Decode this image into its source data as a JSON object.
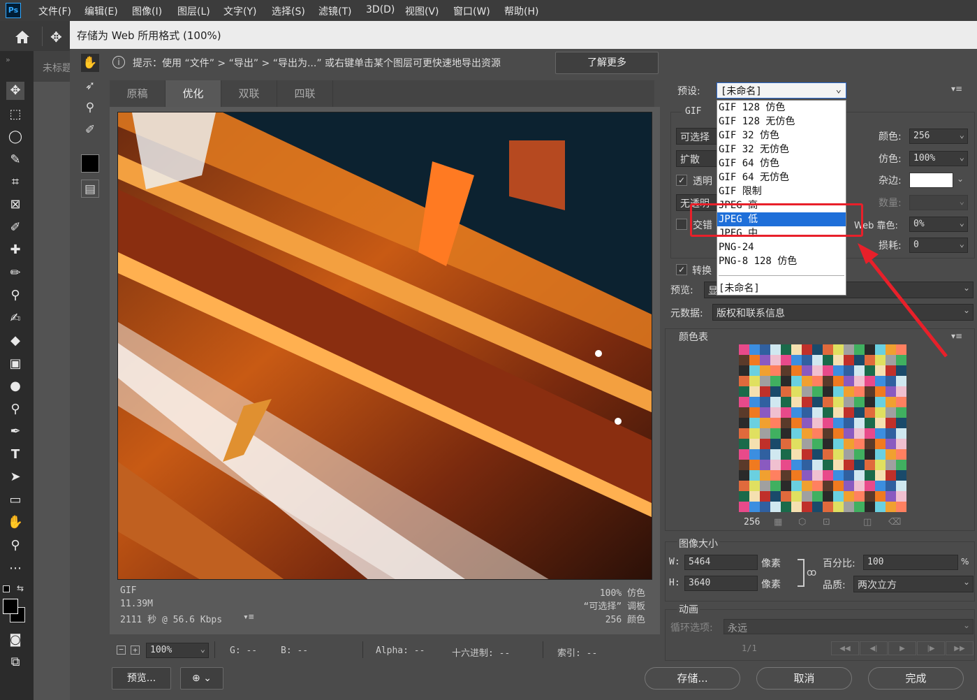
{
  "app": {
    "logo": "Ps"
  },
  "menu": [
    "文件(F)",
    "编辑(E)",
    "图像(I)",
    "图层(L)",
    "文字(Y)",
    "选择(S)",
    "滤镜(T)",
    "3D(D)",
    "视图(V)",
    "窗口(W)",
    "帮助(H)"
  ],
  "doc_tab": "未标题",
  "dialog": {
    "title": "存储为 Web 所用格式 (100%)",
    "hint": "提示：使用 “文件” > “导出” > “导出为...” 或右键单击某个图层可更快速地导出资源",
    "learn_more": "了解更多",
    "tabs": [
      "原稿",
      "优化",
      "双联",
      "四联"
    ],
    "active_tab": "优化"
  },
  "image_info": {
    "format": "GIF",
    "size": "11.39M",
    "time": "2111 秒 @ 56.6 Kbps",
    "dither": "100% 仿色",
    "palette": "“可选择” 调板",
    "colors": "256 颜色"
  },
  "statusbar": {
    "zoom": "100%",
    "g": "G: --",
    "b": "B: --",
    "alpha": "Alpha: --",
    "hex": "十六进制: --",
    "index": "索引: --"
  },
  "bottom_buttons": {
    "preview": "预览...",
    "save": "存储...",
    "cancel": "取消",
    "done": "完成"
  },
  "settings": {
    "preset_label": "预设:",
    "preset_value": "[未命名]",
    "format": "GIF",
    "reduction": "可选择",
    "dither_algo": "扩散",
    "transparency_label": "透明",
    "transparency_checked": true,
    "matte_dither": "无透明",
    "interlaced_label": "交错",
    "interlaced_checked": false,
    "web_snap_label": "Web 靠色:",
    "colors_label": "颜色:",
    "colors_value": "256",
    "dither_label": "仿色:",
    "dither_value": "100%",
    "matte_label": "杂边:",
    "amount_label": "数量:",
    "web_snap_value": "0%",
    "lossy_label": "损耗:",
    "lossy_value": "0",
    "convert_label": "转换",
    "convert_checked": true,
    "preview_label": "预览:",
    "preview_value": "显",
    "metadata_label": "元数据:",
    "metadata_value": "版权和联系信息"
  },
  "preset_options": [
    "GIF 128 仿色",
    "GIF 128 无仿色",
    "GIF 32 仿色",
    "GIF 32 无仿色",
    "GIF 64 仿色",
    "GIF 64 无仿色",
    "GIF 限制",
    "JPEG 高",
    "JPEG 低",
    "JPEG 中",
    "PNG-24",
    "PNG-8 128 仿色",
    "[未命名]"
  ],
  "preset_selected": "JPEG 低",
  "color_table": {
    "label": "颜色表",
    "count": "256"
  },
  "image_size": {
    "label": "图像大小",
    "w_label": "W:",
    "w_value": "5464",
    "h_label": "H:",
    "h_value": "3640",
    "unit": "像素",
    "percent_label": "百分比:",
    "percent_value": "100",
    "percent_sign": "%",
    "quality_label": "品质:",
    "quality_value": "两次立方"
  },
  "animation": {
    "label": "动画",
    "loop_label": "循环选项:",
    "loop_value": "永远",
    "frame": "1/1"
  },
  "colors": {
    "annotation_red": "#e8202a",
    "selection_blue": "#1e6fd9"
  }
}
